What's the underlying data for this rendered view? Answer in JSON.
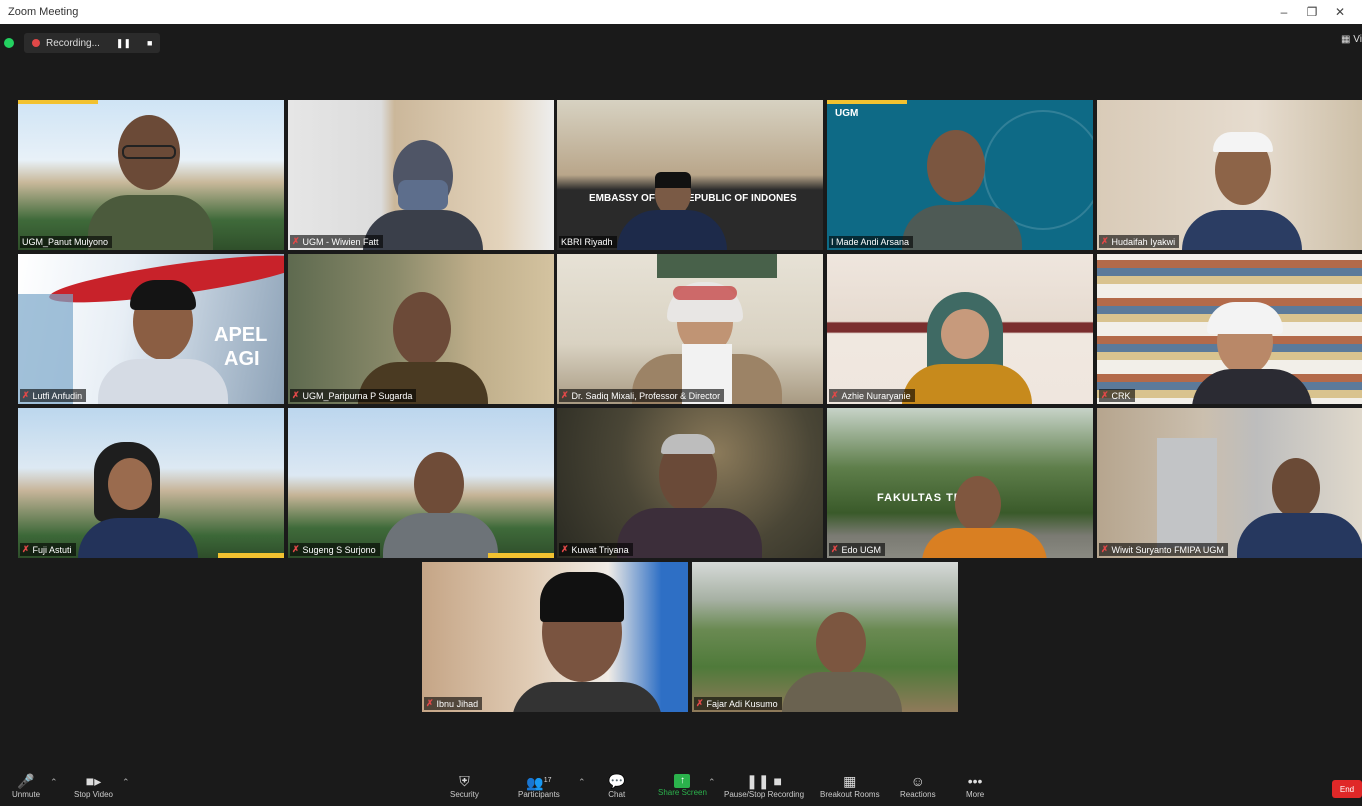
{
  "window": {
    "title": "Zoom Meeting"
  },
  "recording": {
    "label": "Recording..."
  },
  "view": {
    "label": "Vi"
  },
  "participants": [
    {
      "name": "UGM_Panut Mulyono",
      "muted": false
    },
    {
      "name": "UGM - Wiwien Fatt",
      "muted": true
    },
    {
      "name": "KBRI Riyadh",
      "muted": false
    },
    {
      "name": "I Made Andi Arsana",
      "muted": false
    },
    {
      "name": "Hudaifah Iyakwi",
      "muted": true
    },
    {
      "name": "Lutfi Anfudin",
      "muted": true
    },
    {
      "name": "UGM_Paripurna P Sugarda",
      "muted": true
    },
    {
      "name": "Dr. Sadiq Mixali, Professor & Director",
      "muted": true
    },
    {
      "name": "Azhie Nuraryanie",
      "muted": true
    },
    {
      "name": "CRK",
      "muted": true
    },
    {
      "name": "Fuji Astuti",
      "muted": true
    },
    {
      "name": "Sugeng S Surjono",
      "muted": true
    },
    {
      "name": "Kuwat Triyana",
      "muted": true
    },
    {
      "name": "Edo UGM",
      "muted": true
    },
    {
      "name": "Wiwit Suryanto FMIPA UGM",
      "muted": true
    },
    {
      "name": "Ibnu Jihad",
      "muted": true
    },
    {
      "name": "Fajar Adi Kusumo",
      "muted": true
    }
  ],
  "backgrounds": {
    "banner_text_1": "EMBASSY OF THE REPUBLIC OF INDONES",
    "banner_text_2": "FAKULTAS TEKNIK",
    "brand_text": "UGM",
    "apel_text": "APEL",
    "apel_text_2": "AGI"
  },
  "toolbar": {
    "unmute": "Unmute",
    "stop_video": "Stop Video",
    "security": "Security",
    "participants": "Participants",
    "participants_count": "17",
    "chat": "Chat",
    "share_screen": "Share Screen",
    "pause_recording": "Pause/Stop Recording",
    "breakout_rooms": "Breakout Rooms",
    "reactions": "Reactions",
    "more": "More",
    "end": "End"
  },
  "colors": {
    "accent_green": "#23d160",
    "share_green": "#2bb24c",
    "end_red": "#e02828",
    "active_speaker": "#c7e34a"
  }
}
